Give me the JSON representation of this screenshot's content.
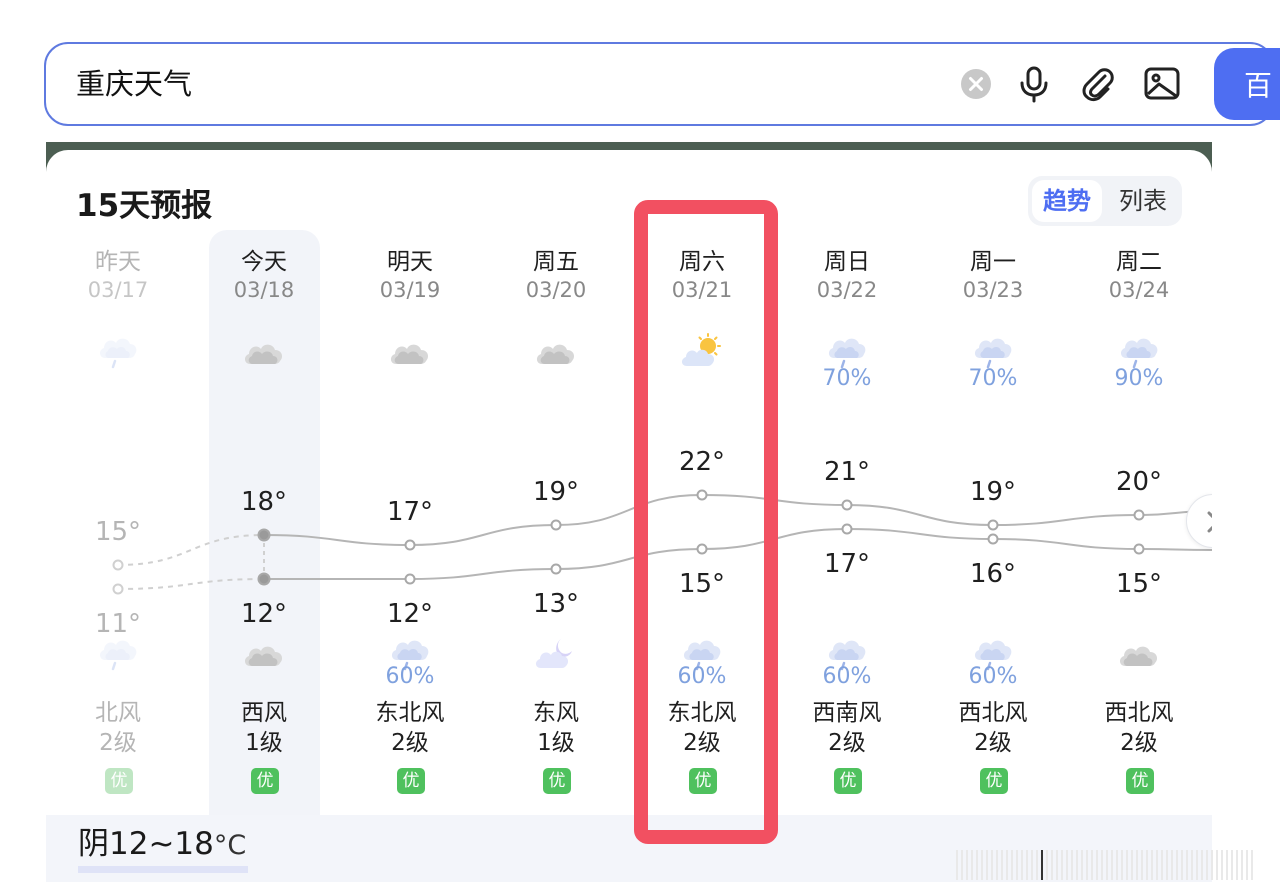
{
  "search": {
    "query": "重庆天气",
    "submit_label": "百",
    "icons": [
      "clear-icon",
      "microphone-icon",
      "paperclip-icon",
      "image-icon"
    ]
  },
  "forecast": {
    "title": "15天预报",
    "view_toggle": {
      "trend": "趋势",
      "list": "列表",
      "active": "趋势"
    },
    "summary": {
      "condition": "阴",
      "range": "12~18",
      "unit": "°C"
    },
    "days": [
      {
        "day": "昨天",
        "date": "03/17",
        "day_icon": "cloud-rain-icon",
        "day_prob": "",
        "high": "15°",
        "high_value": 15,
        "low": "11°",
        "low_value": 11,
        "night_icon": "cloud-rain-icon",
        "night_prob": "",
        "wind_dir": "北风",
        "wind_level": "2级",
        "aqi": "优",
        "past": true
      },
      {
        "day": "今天",
        "date": "03/18",
        "day_icon": "cloud-icon",
        "day_prob": "",
        "high": "18°",
        "high_value": 18,
        "low": "12°",
        "low_value": 12,
        "night_icon": "cloud-icon",
        "night_prob": "",
        "wind_dir": "西风",
        "wind_level": "1级",
        "aqi": "优",
        "past": false
      },
      {
        "day": "明天",
        "date": "03/19",
        "day_icon": "cloud-icon",
        "day_prob": "",
        "high": "17°",
        "high_value": 17,
        "low": "12°",
        "low_value": 12,
        "night_icon": "cloud-rain-icon",
        "night_prob": "60%",
        "wind_dir": "东北风",
        "wind_level": "2级",
        "aqi": "优",
        "past": false
      },
      {
        "day": "周五",
        "date": "03/20",
        "day_icon": "cloud-icon",
        "day_prob": "",
        "high": "19°",
        "high_value": 19,
        "low": "13°",
        "low_value": 13,
        "night_icon": "moon-cloud-icon",
        "night_prob": "",
        "wind_dir": "东风",
        "wind_level": "1级",
        "aqi": "优",
        "past": false
      },
      {
        "day": "周六",
        "date": "03/21",
        "day_icon": "sun-cloud-icon",
        "day_prob": "",
        "high": "22°",
        "high_value": 22,
        "low": "15°",
        "low_value": 15,
        "night_icon": "cloud-rain-icon",
        "night_prob": "60%",
        "wind_dir": "东北风",
        "wind_level": "2级",
        "aqi": "优",
        "past": false
      },
      {
        "day": "周日",
        "date": "03/22",
        "day_icon": "cloud-rain-icon",
        "day_prob": "70%",
        "high": "21°",
        "high_value": 21,
        "low": "17°",
        "low_value": 17,
        "night_icon": "cloud-rain-icon",
        "night_prob": "60%",
        "wind_dir": "西南风",
        "wind_level": "2级",
        "aqi": "优",
        "past": false
      },
      {
        "day": "周一",
        "date": "03/23",
        "day_icon": "cloud-rain-icon",
        "day_prob": "70%",
        "high": "19°",
        "high_value": 19,
        "low": "16°",
        "low_value": 16,
        "night_icon": "cloud-rain-icon",
        "night_prob": "60%",
        "wind_dir": "西北风",
        "wind_level": "2级",
        "aqi": "优",
        "past": false
      },
      {
        "day": "周二",
        "date": "03/24",
        "day_icon": "cloud-rain-icon",
        "day_prob": "90%",
        "high": "20°",
        "high_value": 20,
        "low": "15°",
        "low_value": 15,
        "night_icon": "cloud-icon",
        "night_prob": "",
        "wind_dir": "西北风",
        "wind_level": "2级",
        "aqi": "优",
        "past": false
      }
    ],
    "highlighted_day": "周六",
    "highlight_color": "#f25061",
    "accent_color": "#4e6ef2",
    "aqi_color": "#4fc15e"
  }
}
